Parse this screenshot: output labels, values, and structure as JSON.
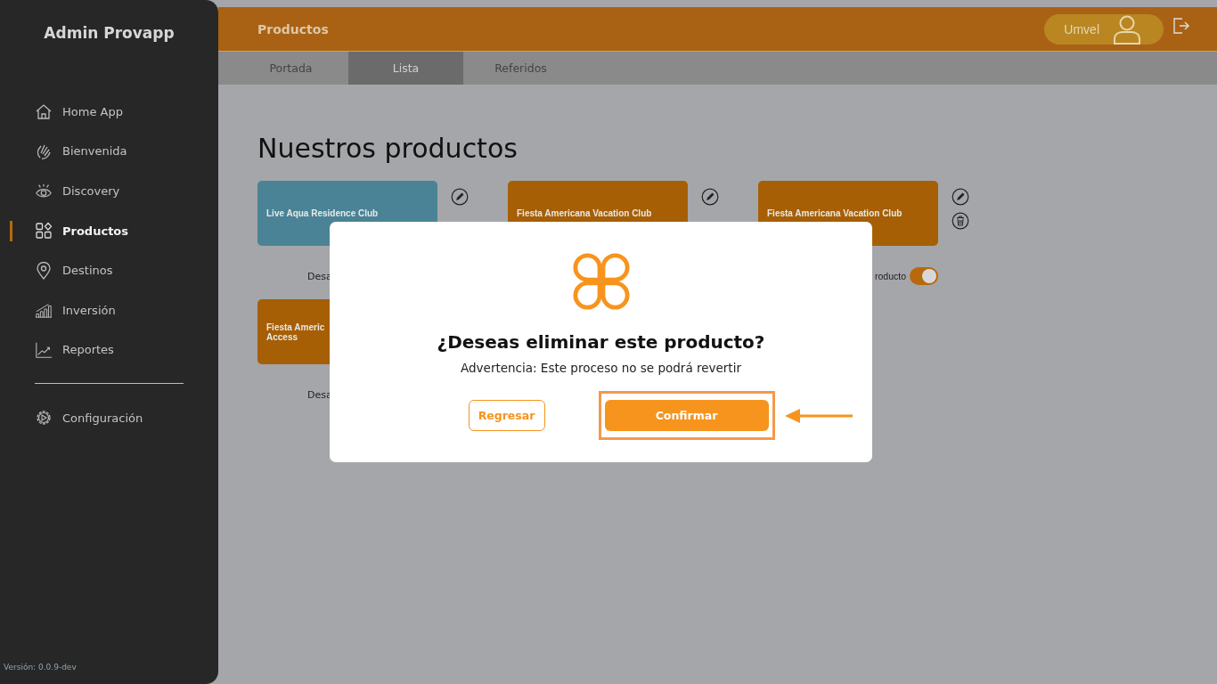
{
  "sidebar": {
    "title": "Admin Provapp",
    "items": [
      {
        "label": "Home App",
        "selected": false
      },
      {
        "label": "Bienvenida",
        "selected": false
      },
      {
        "label": "Discovery",
        "selected": false
      },
      {
        "label": "Productos",
        "selected": true
      },
      {
        "label": "Destinos",
        "selected": false
      },
      {
        "label": "Inversión",
        "selected": false
      },
      {
        "label": "Reportes",
        "selected": false
      }
    ],
    "settings": {
      "label": "Configuración"
    },
    "version": "Versión: 0.0.9-dev"
  },
  "header": {
    "title": "Productos",
    "user": "Umvel"
  },
  "tabs": [
    {
      "label": "Portada",
      "selected": false
    },
    {
      "label": "Lista",
      "selected": true
    },
    {
      "label": "Referidos",
      "selected": false
    }
  ],
  "page_title": "Nuestros productos",
  "products": [
    {
      "title": "Live Aqua Residence Club",
      "color": "#4a8396",
      "edit_icon": true,
      "delete_icon": false,
      "caption": "Desa"
    },
    {
      "title": "Fiesta Americana Vacation Club",
      "color": "#a65f05",
      "edit_icon": true,
      "delete_icon": false
    },
    {
      "title": "Fiesta Americana Vacation Club",
      "color": "#a65f05",
      "edit_icon": true,
      "delete_icon": true,
      "caption": "roducto",
      "toggle_on": true
    },
    {
      "title": "Fiesta Americ\nAccess",
      "color": "#a65f05",
      "edit_icon": false,
      "delete_icon": false,
      "caption": "Desa"
    }
  ],
  "modal": {
    "title": "¿Deseas eliminar este producto?",
    "message": "Advertencia: Este proceso no se podrá revertir",
    "buttons": [
      {
        "label": "Regresar",
        "kind": "secondary",
        "highlighted": false
      },
      {
        "label": "Confirmar",
        "kind": "primary",
        "highlighted": true
      }
    ]
  }
}
